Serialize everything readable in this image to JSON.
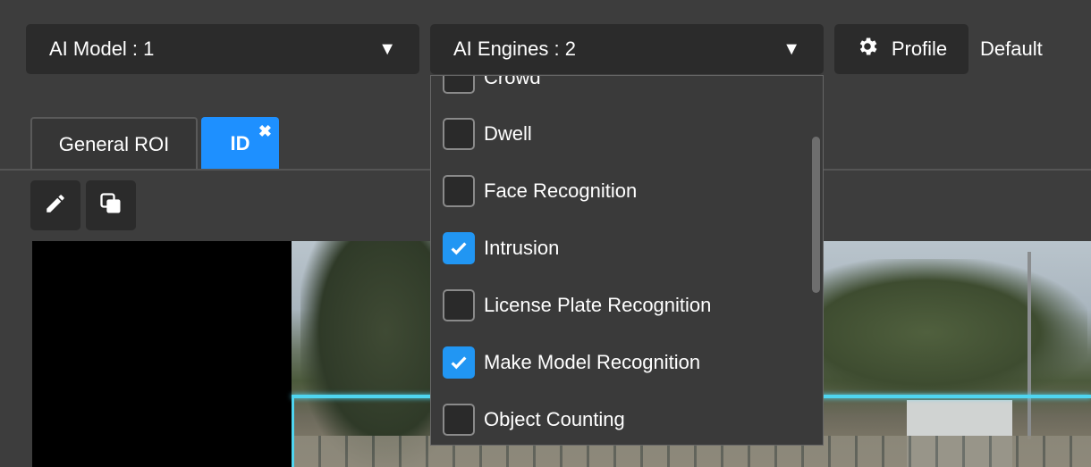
{
  "ai_model": {
    "label": "AI Model : 1"
  },
  "ai_engines": {
    "label": "AI Engines : 2"
  },
  "profile": {
    "button_label": "Profile",
    "value": "Default"
  },
  "tabs": [
    {
      "label": "General ROI",
      "active": false
    },
    {
      "label": "ID",
      "active": true
    }
  ],
  "engine_options": [
    {
      "label": "Crowd",
      "checked": false
    },
    {
      "label": "Dwell",
      "checked": false
    },
    {
      "label": "Face Recognition",
      "checked": false
    },
    {
      "label": "Intrusion",
      "checked": true
    },
    {
      "label": "License Plate Recognition",
      "checked": false
    },
    {
      "label": "Make Model Recognition",
      "checked": true
    },
    {
      "label": "Object Counting",
      "checked": false
    }
  ],
  "icons": {
    "dropdown_arrow": "caret-down-icon",
    "profile": "gear-icon",
    "close_tab": "close-icon",
    "edit": "pencil-icon",
    "copy": "copy-icon",
    "check": "checkmark-icon"
  },
  "colors": {
    "accent": "#1e90ff",
    "checkbox_checked": "#2196f3",
    "roi_line": "#4fd5f0",
    "panel": "#2b2b2b",
    "background": "#3d3d3d"
  }
}
